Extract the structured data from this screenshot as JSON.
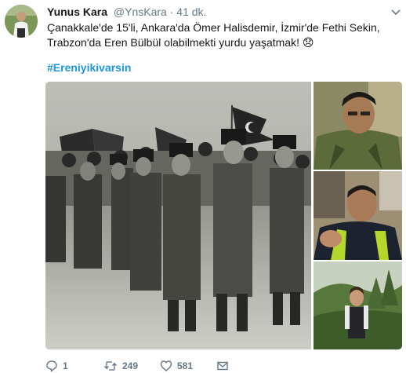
{
  "author": {
    "name": "Yunus Kara",
    "handle": "@YnsKara",
    "separator": "·",
    "time": "41 dk."
  },
  "tweet": {
    "text": "Çanakkale'de 15'li, Ankara'da Ömer Halisdemir, İzmir'de Fethi Sekin, Trabzon'da Eren Bülbül olabilmekti yurdu yaşatmak! 😞",
    "hashtag": "#Ereniyikivarsin"
  },
  "media": {
    "main_photo": "historic-soldiers-march-photo",
    "side_photos": [
      "soldier-portrait-photo",
      "police-officer-photo",
      "boy-in-forest-photo"
    ]
  },
  "stats": {
    "replies": "1",
    "retweets": "249",
    "likes": "581"
  },
  "colors": {
    "link": "#1b95e0",
    "muted": "#657786",
    "text": "#14171a"
  }
}
